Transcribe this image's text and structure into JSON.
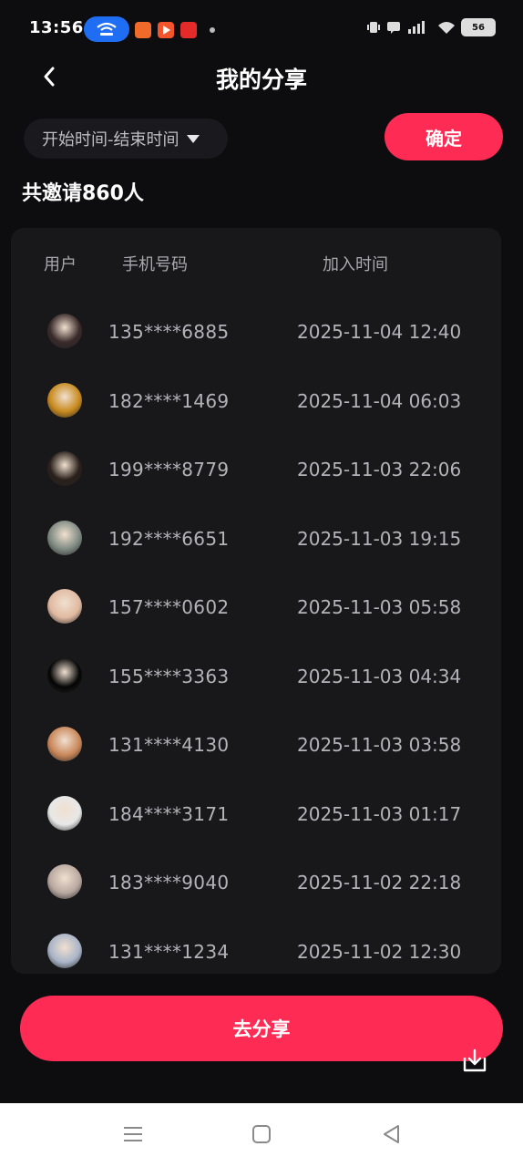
{
  "status_bar": {
    "time": "13:56",
    "battery": "56"
  },
  "header": {
    "title": "我的分享",
    "back_icon": "chevron-left-icon"
  },
  "filter": {
    "date_range_label": "开始时间-结束时间",
    "confirm_label": "确定"
  },
  "summary": {
    "invite_total": "共邀请860人"
  },
  "table": {
    "columns": [
      "用户",
      "手机号码",
      "加入时间"
    ],
    "rows": [
      {
        "phone": "135****6885",
        "joined": "2025-11-04 12:40",
        "avatar_color": "#3a2a2a"
      },
      {
        "phone": "182****1469",
        "joined": "2025-11-04 06:03",
        "avatar_color": "#c88a1e"
      },
      {
        "phone": "199****8779",
        "joined": "2025-11-03 22:06",
        "avatar_color": "#2a201a"
      },
      {
        "phone": "192****6651",
        "joined": "2025-11-03 19:15",
        "avatar_color": "#7f8a82"
      },
      {
        "phone": "157****0602",
        "joined": "2025-11-03 05:58",
        "avatar_color": "#e0b9a0"
      },
      {
        "phone": "155****3363",
        "joined": "2025-11-03 04:34",
        "avatar_color": "#050505"
      },
      {
        "phone": "131****4130",
        "joined": "2025-11-03 03:58",
        "avatar_color": "#c9875a"
      },
      {
        "phone": "184****3171",
        "joined": "2025-11-03 01:17",
        "avatar_color": "#e8e8e8"
      },
      {
        "phone": "183****9040",
        "joined": "2025-11-02 22:18",
        "avatar_color": "#b8a8a0"
      },
      {
        "phone": "131****1234",
        "joined": "2025-11-02 12:30",
        "avatar_color": "#a9b4c8"
      }
    ]
  },
  "footer": {
    "share_label": "去分享",
    "download_icon": "download-icon"
  },
  "colors": {
    "accent": "#fe2b54",
    "background": "#0d0d10",
    "card": "#18181b"
  }
}
